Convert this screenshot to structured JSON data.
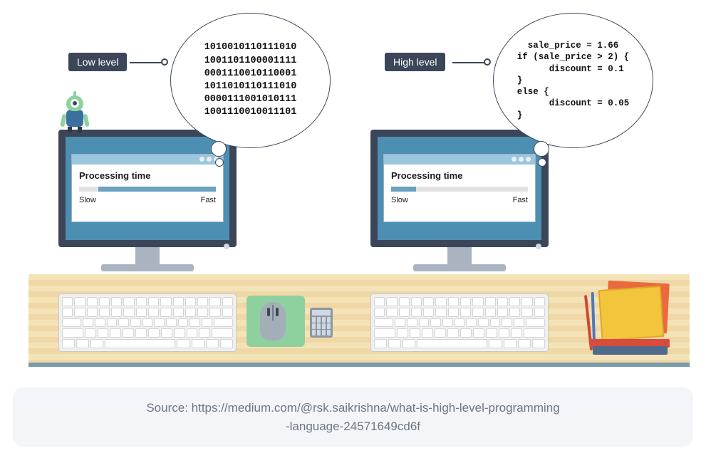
{
  "labels": {
    "low_level": "Low level",
    "high_level": "High level"
  },
  "low_level_bubble": {
    "lines": [
      "1010010110111010",
      "1001101100001111",
      "0001110010110001",
      "1011010110111010",
      "0000111001010111",
      "1001110010011101"
    ]
  },
  "high_level_bubble": {
    "code": "  sale_price = 1.66\nif (sale_price > 2) {\n      discount = 0.1\n}\nelse {\n      discount = 0.05\n}"
  },
  "window": {
    "title": "Processing time",
    "slow_label": "Slow",
    "fast_label": "Fast"
  },
  "bar_fill": {
    "low_level_percent": 86,
    "low_level_side": "right",
    "high_level_percent": 18,
    "high_level_side": "left"
  },
  "source": {
    "line1": "Source: https://medium.com/@rsk.saikrishna/what-is-high-level-programming",
    "line2": "-language-24571649cd6f"
  }
}
